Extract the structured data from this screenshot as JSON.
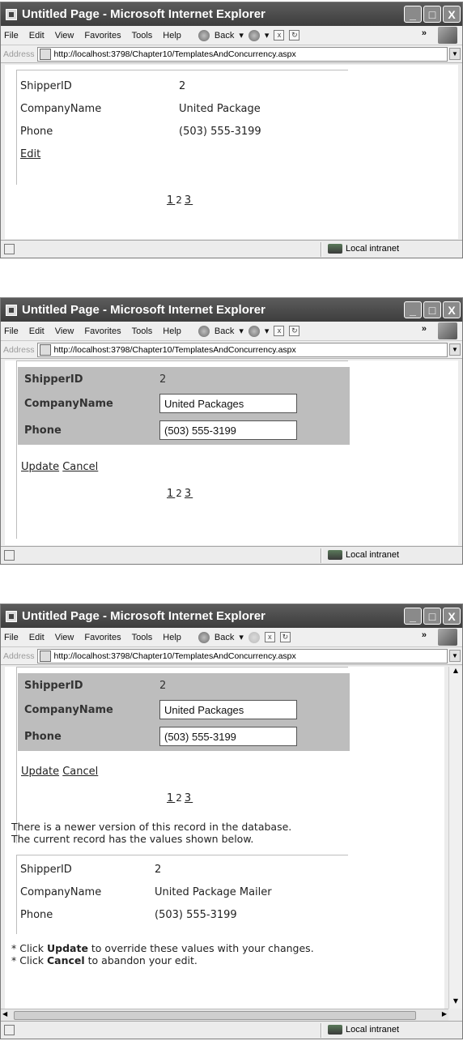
{
  "browser": {
    "title": "Untitled Page - Microsoft Internet Explorer",
    "menu": [
      "File",
      "Edit",
      "View",
      "Favorites",
      "Tools",
      "Help"
    ],
    "back_label": "Back",
    "chevron": "»",
    "address_label": "Address",
    "url": "http://localhost:3798/Chapter10/TemplatesAndConcurrency.aspx",
    "status_zone": "Local intranet",
    "window_buttons": {
      "minimize": "_",
      "maximize": "□",
      "close": "X"
    }
  },
  "screen1": {
    "fields": [
      {
        "label": "ShipperID",
        "value": "2"
      },
      {
        "label": "CompanyName",
        "value": "United Package"
      },
      {
        "label": "Phone",
        "value": "(503) 555-3199"
      }
    ],
    "edit_link": "Edit",
    "pager": [
      "1",
      "2",
      "3"
    ]
  },
  "screen2": {
    "id_label": "ShipperID",
    "id_value": "2",
    "company_label": "CompanyName",
    "company_value": "United Packages",
    "phone_label": "Phone",
    "phone_value": "(503) 555-3199",
    "update_link": "Update",
    "cancel_link": "Cancel",
    "pager": [
      "1",
      "2",
      "3"
    ]
  },
  "screen3": {
    "id_label": "ShipperID",
    "id_value": "2",
    "company_label": "CompanyName",
    "company_value": "United Packages",
    "phone_label": "Phone",
    "phone_value": "(503) 555-3199",
    "update_link": "Update",
    "cancel_link": "Cancel",
    "pager": [
      "1",
      "2",
      "3"
    ],
    "message_line1": "There is a newer version of this record in the database.",
    "message_line2": "The current record has the values shown below.",
    "db_fields": [
      {
        "label": "ShipperID",
        "value": "2"
      },
      {
        "label": "CompanyName",
        "value": "United Package Mailer"
      },
      {
        "label": "Phone",
        "value": "(503) 555-3199"
      }
    ],
    "hint1_prefix": "* Click ",
    "hint1_bold": "Update",
    "hint1_suffix": " to override these values with your changes.",
    "hint2_prefix": "* Click ",
    "hint2_bold": "Cancel",
    "hint2_suffix": " to abandon your edit."
  }
}
